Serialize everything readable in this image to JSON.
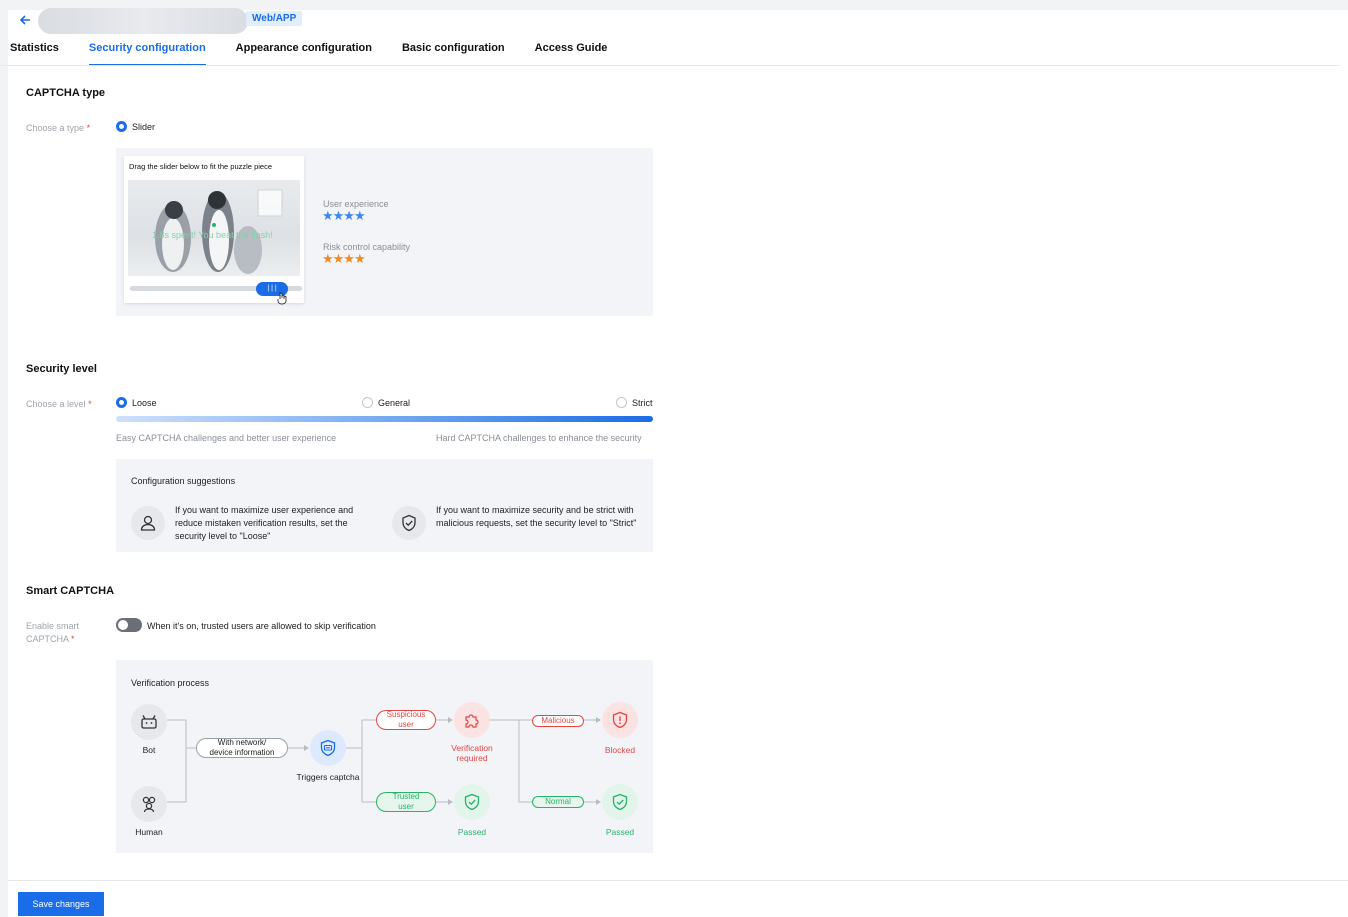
{
  "header": {
    "badge": "Web/APP"
  },
  "tabs": [
    {
      "label": "Statistics"
    },
    {
      "label": "Security configuration"
    },
    {
      "label": "Appearance configuration"
    },
    {
      "label": "Basic configuration"
    },
    {
      "label": "Access Guide"
    }
  ],
  "captcha_type": {
    "title": "CAPTCHA type",
    "field_label": "Choose a type",
    "option": "Slider",
    "preview_instruction": "Drag the slider below to fit the puzzle piece",
    "preview_caption": "1.8s spent! You beat the flash!",
    "knob_glyph": "| | |",
    "user_experience_label": "User experience",
    "user_experience_stars": "★★★★",
    "risk_label": "Risk control capability",
    "risk_stars": "★★★★"
  },
  "security_level": {
    "title": "Security level",
    "field_label": "Choose a level",
    "options": [
      "Loose",
      "General",
      "Strict"
    ],
    "selected": "Loose",
    "hint_left": "Easy CAPTCHA challenges and better user experience",
    "hint_right": "Hard CAPTCHA challenges to enhance the security",
    "suggestions_title": "Configuration suggestions",
    "suggestion_user": "If you want to maximize user experience and reduce mistaken verification results, set the security level to \"Loose\"",
    "suggestion_security": "If you want to maximize security and be strict with malicious requests, set the security level to \"Strict\""
  },
  "smart_captcha": {
    "title": "Smart CAPTCHA",
    "field_label_1": "Enable smart",
    "field_label_2": "CAPTCHA",
    "toggle_text": "When it's on, trusted users are allowed to skip verification",
    "toggle_on": false,
    "process_title": "Verification process",
    "bot": "Bot",
    "human": "Human",
    "network_pill_1": "With network/",
    "network_pill_2": "device information",
    "triggers": "Triggers captcha",
    "suspicious_1": "Suspicious",
    "suspicious_2": "user",
    "trusted_1": "Trusted",
    "trusted_2": "user",
    "verification_1": "Verification",
    "verification_2": "required",
    "passed": "Passed",
    "malicious": "Malicious",
    "normal": "Normal",
    "blocked": "Blocked",
    "passed_2": "Passed"
  },
  "footer": {
    "save_label": "Save changes"
  },
  "colors": {
    "accent": "#1a6ce8",
    "danger": "#e54545",
    "success": "#27b36a",
    "star_blue": "#3d86f0",
    "star_orange": "#f08a28"
  }
}
